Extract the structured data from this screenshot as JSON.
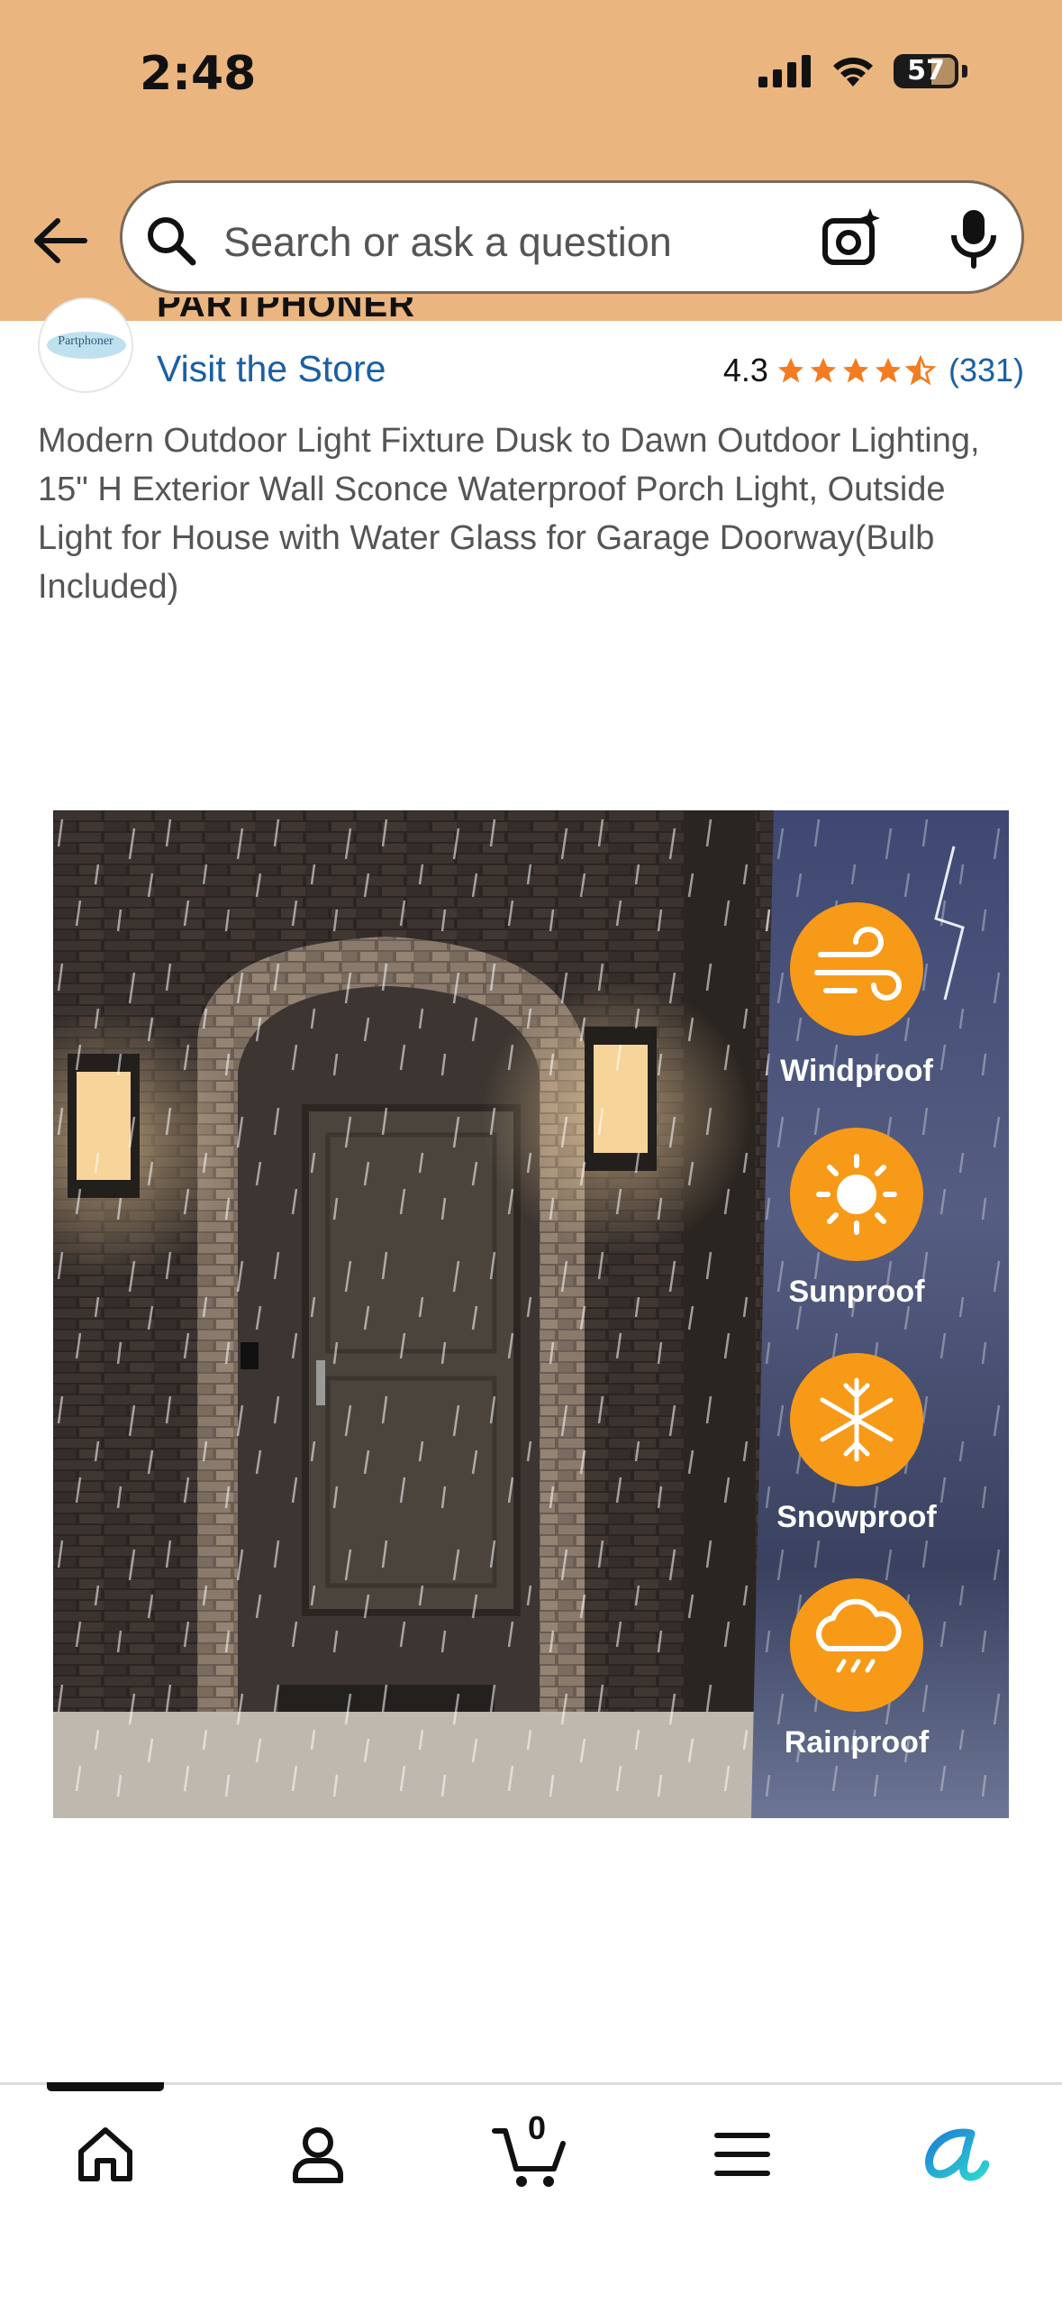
{
  "status_bar": {
    "time": "2:48",
    "battery": "57"
  },
  "search": {
    "placeholder": "Search or ask a question"
  },
  "store": {
    "brand": "PARTPHONER",
    "logo_text": "Partphoner",
    "visit_label": "Visit the Store",
    "rating": "4.3",
    "rating_value": 4.3,
    "rating_count": "(331)"
  },
  "product": {
    "title": "Modern Outdoor Light Fixture Dusk to Dawn Outdoor Lighting, 15\" H Exterior Wall Sconce Waterproof Porch Light, Outside Light for House with Water Glass for Garage Doorway(Bulb Included)",
    "features": [
      "Windproof",
      "Sunproof",
      "Snowproof",
      "Rainproof"
    ]
  },
  "nav": {
    "items": [
      "home-icon",
      "account-icon",
      "cart-icon",
      "menu-icon",
      "rufus-icon"
    ],
    "cart_count": "0"
  },
  "colors": {
    "header_bg": "#eab57f",
    "link": "#1a5fa4",
    "star": "#f47b20",
    "feature_badge": "#f79a18"
  }
}
